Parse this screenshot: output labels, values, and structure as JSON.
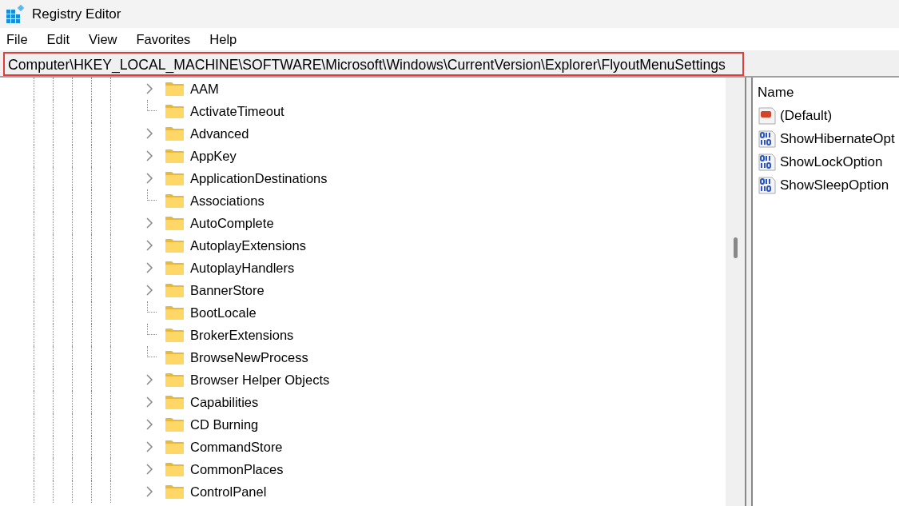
{
  "window": {
    "title": "Registry Editor"
  },
  "menu": [
    "File",
    "Edit",
    "View",
    "Favorites",
    "Help"
  ],
  "address": {
    "path": "Computer\\HKEY_LOCAL_MACHINE\\SOFTWARE\\Microsoft\\Windows\\CurrentVersion\\Explorer\\FlyoutMenuSettings",
    "highlighted": true
  },
  "tree": [
    {
      "label": "AAM",
      "expandable": true
    },
    {
      "label": "ActivateTimeout",
      "expandable": false
    },
    {
      "label": "Advanced",
      "expandable": true
    },
    {
      "label": "AppKey",
      "expandable": true
    },
    {
      "label": "ApplicationDestinations",
      "expandable": true
    },
    {
      "label": "Associations",
      "expandable": false
    },
    {
      "label": "AutoComplete",
      "expandable": true
    },
    {
      "label": "AutoplayExtensions",
      "expandable": true
    },
    {
      "label": "AutoplayHandlers",
      "expandable": true
    },
    {
      "label": "BannerStore",
      "expandable": true
    },
    {
      "label": "BootLocale",
      "expandable": false
    },
    {
      "label": "BrokerExtensions",
      "expandable": false
    },
    {
      "label": "BrowseNewProcess",
      "expandable": false
    },
    {
      "label": "Browser Helper Objects",
      "expandable": true
    },
    {
      "label": "Capabilities",
      "expandable": true
    },
    {
      "label": "CD Burning",
      "expandable": true
    },
    {
      "label": "CommandStore",
      "expandable": true
    },
    {
      "label": "CommonPlaces",
      "expandable": true
    },
    {
      "label": "ControlPanel",
      "expandable": true
    }
  ],
  "values": {
    "column": "Name",
    "items": [
      {
        "name": "(Default)",
        "kind": "string"
      },
      {
        "name": "ShowHibernateOpt",
        "kind": "dword"
      },
      {
        "name": "ShowLockOption",
        "kind": "dword"
      },
      {
        "name": "ShowSleepOption",
        "kind": "dword"
      }
    ]
  }
}
